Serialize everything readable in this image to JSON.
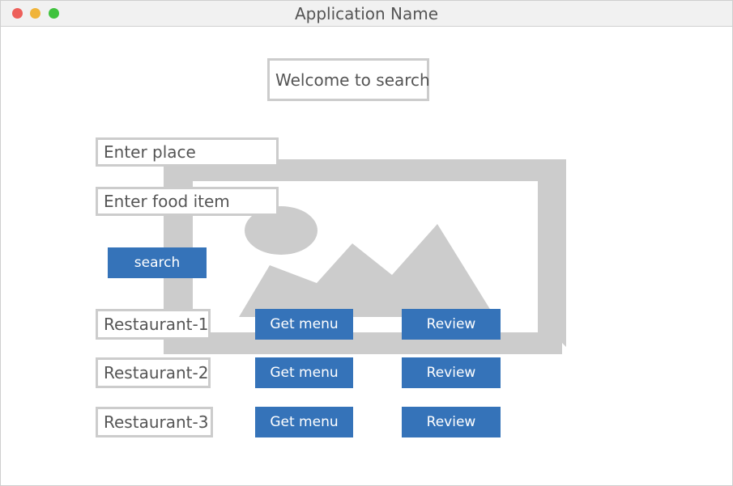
{
  "window": {
    "title": "Application Name"
  },
  "header": {
    "welcome": "Welcome to search"
  },
  "search": {
    "place_placeholder": "Enter place",
    "food_placeholder": "Enter food item",
    "button_label": "search"
  },
  "results": [
    {
      "name": "Restaurant-1",
      "menu_label": "Get menu",
      "review_label": "Review"
    },
    {
      "name": "Restaurant-2",
      "menu_label": "Get menu",
      "review_label": "Review"
    },
    {
      "name": "Restaurant-3",
      "menu_label": "Get menu",
      "review_label": "Review"
    }
  ],
  "image_placeholder": {
    "icon": "image-placeholder-icon"
  },
  "colors": {
    "accent": "#3573b9",
    "border": "#cccccc",
    "placeholder_gray": "#cccccc",
    "close": "#ed5f5a",
    "minimize": "#f0b43a",
    "maximize": "#3fc23d"
  }
}
